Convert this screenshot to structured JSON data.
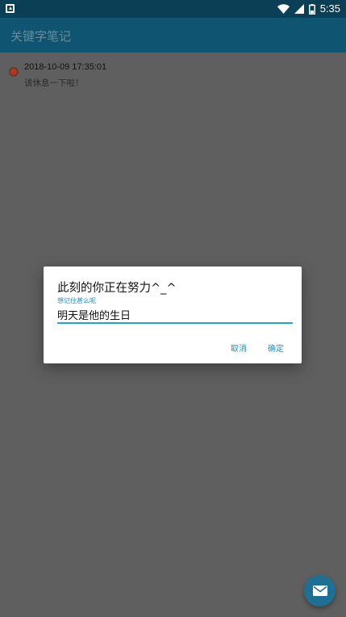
{
  "status_bar": {
    "time": "5:35",
    "icons": [
      "notification-icon",
      "wifi-icon",
      "signal-icon",
      "battery-icon"
    ]
  },
  "app_bar": {
    "title": "关键字笔记"
  },
  "notes": [
    {
      "time": "2018-10-09 17:35:01",
      "text": "该休息一下啦！"
    }
  ],
  "dialog": {
    "title": "此刻的你正在努力^_^",
    "hint": "想记住甚么呢",
    "input_value": "明天是他的生日",
    "cancel_label": "取消",
    "confirm_label": "确定"
  },
  "fab": {
    "icon": "envelope-icon"
  },
  "colors": {
    "status_bar": "#0b3f56",
    "app_bar": "#0f5470",
    "scrim": "#5f5f5f",
    "accent": "#1e8fc2",
    "note_dot": "#b0391f",
    "fab": "#1f6f95"
  }
}
